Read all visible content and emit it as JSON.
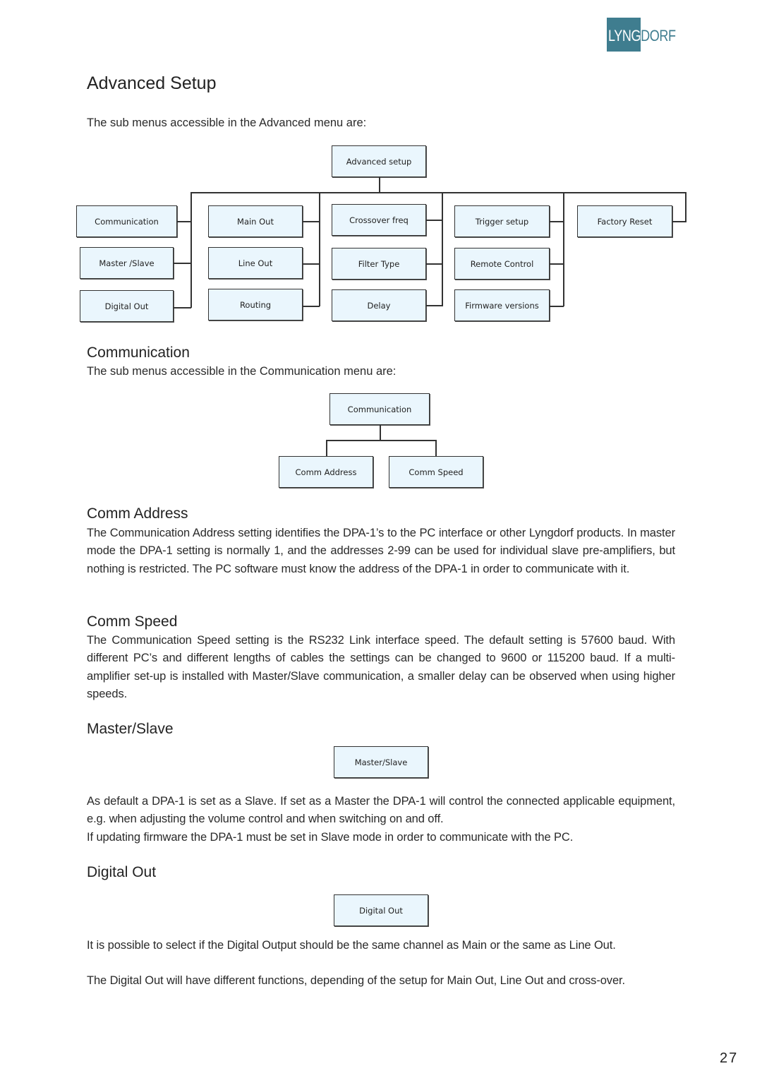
{
  "logo": {
    "part1": "LYNG",
    "part2": "DORF",
    "brand_color": "#3f7d8f"
  },
  "page_title": "Advanced Setup",
  "advanced": {
    "intro": "The sub menus accessible in the Advanced menu are:",
    "root": "Advanced setup",
    "columns": [
      [
        "Communication",
        "Master /Slave",
        "Digital Out"
      ],
      [
        "Main Out",
        "Line Out",
        "Routing"
      ],
      [
        "Crossover freq",
        "Filter Type",
        "Delay"
      ],
      [
        "Trigger setup",
        "Remote Control",
        "Firmware versions"
      ],
      [
        "Factory Reset"
      ]
    ]
  },
  "communication": {
    "heading": "Communication",
    "intro": "The sub menus accessible in the Communication menu are:",
    "root": "Communication",
    "children": [
      "Comm Address",
      "Comm Speed"
    ]
  },
  "comm_address": {
    "heading": "Comm Address",
    "text": "The Communication Address setting identifies the DPA-1’s to the PC interface or other Lyngdorf products. In master mode the DPA-1 setting is normally 1, and the addresses 2-99 can be used for individual slave pre-amplifiers, but nothing is restricted. The PC software must know the address of the DPA-1 in order to communicate with it."
  },
  "comm_speed": {
    "heading": "Comm Speed",
    "text": "The Communication Speed setting is the RS232 Link interface speed. The default setting is 57600 baud. With different PC’s and different lengths of cables the settings can be changed to 9600 or 115200 baud. If a multi-amplifier set-up is installed with Master/Slave communication, a smaller delay can be observed when using higher speeds."
  },
  "master_slave": {
    "heading": "Master/Slave",
    "box": "Master/Slave",
    "text1": "As default a DPA-1 is set as a Slave. If set as a Master the DPA-1 will control the connected applicable equipment, e.g. when adjusting the volume control and when switching on and off.",
    "text2": "If updating firmware the DPA-1 must be set in Slave mode in order to communicate with the PC."
  },
  "digital_out": {
    "heading": "Digital Out",
    "box": "Digital Out",
    "text1": "It is possible to select if the Digital Output should be the same channel as Main or the same as Line Out.",
    "text2": "The Digital Out will have different functions, depending of the setup for Main Out, Line Out and cross-over."
  },
  "page_number": "27"
}
